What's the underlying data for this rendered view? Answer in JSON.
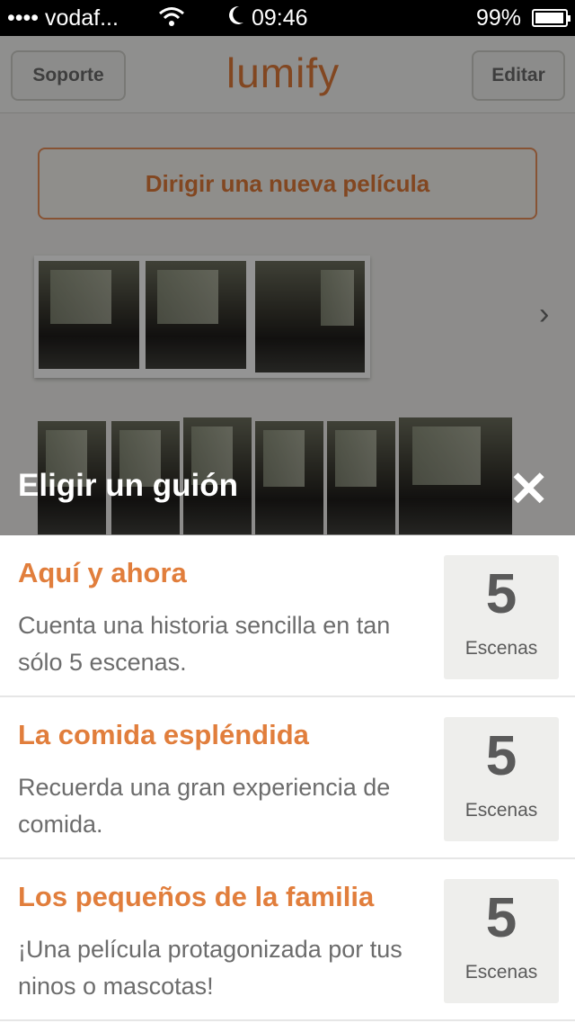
{
  "status": {
    "carrier": "•••• vodaf...",
    "wifi_icon": "wifi-icon",
    "moon_icon": "moon-icon",
    "time": "09:46",
    "battery_pct": "99%",
    "battery_level": 0.99
  },
  "background": {
    "nav_left": "Soporte",
    "logo": "lumify",
    "nav_right": "Editar",
    "new_film": "Dirigir una nueva película",
    "more_icon": "chevron-right-icon"
  },
  "sheet": {
    "title": "Eligir un guión",
    "close_icon": "close-icon"
  },
  "scripts": [
    {
      "title": "Aquí y ahora",
      "description": "Cuenta una historia sencilla en tan sólo 5 escenas.",
      "scene_count": "5",
      "scene_label": "Escenas"
    },
    {
      "title": "La comida espléndida",
      "description": "Recuerda una gran experiencia de comida.",
      "scene_count": "5",
      "scene_label": "Escenas"
    },
    {
      "title": "Los pequeños de la familia",
      "description": "¡Una película protagonizada por tus ninos o mascotas!",
      "scene_count": "5",
      "scene_label": "Escenas"
    }
  ],
  "colors": {
    "accent": "#e17e3c",
    "status_bar": "#000000"
  }
}
